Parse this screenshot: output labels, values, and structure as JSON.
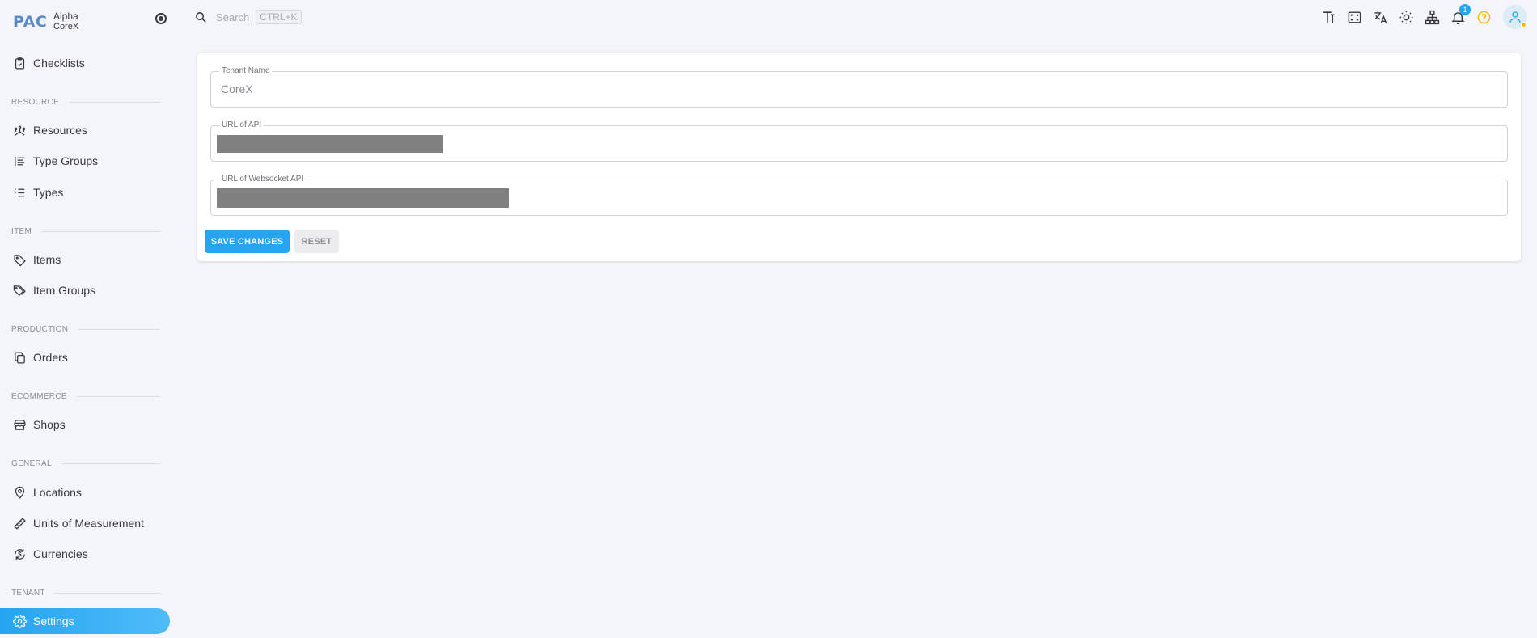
{
  "brand": {
    "logo": "PAC",
    "line1": "Alpha",
    "line2": "CoreX"
  },
  "sidebar": {
    "top_item": {
      "label": "Checklists",
      "icon": "checklist-icon"
    },
    "sections": [
      {
        "title": "RESOURCE",
        "items": [
          {
            "label": "Resources",
            "icon": "resources-icon"
          },
          {
            "label": "Type Groups",
            "icon": "type-groups-icon"
          },
          {
            "label": "Types",
            "icon": "types-icon"
          }
        ]
      },
      {
        "title": "ITEM",
        "items": [
          {
            "label": "Items",
            "icon": "tag-icon"
          },
          {
            "label": "Item Groups",
            "icon": "tags-icon"
          }
        ]
      },
      {
        "title": "PRODUCTION",
        "items": [
          {
            "label": "Orders",
            "icon": "orders-icon"
          }
        ]
      },
      {
        "title": "ECOMMERCE",
        "items": [
          {
            "label": "Shops",
            "icon": "shop-icon"
          }
        ]
      },
      {
        "title": "GENERAL",
        "items": [
          {
            "label": "Locations",
            "icon": "location-icon"
          },
          {
            "label": "Units of Measurement",
            "icon": "ruler-icon"
          },
          {
            "label": "Currencies",
            "icon": "currency-icon"
          }
        ]
      },
      {
        "title": "TENANT",
        "items": [
          {
            "label": "Settings",
            "icon": "gear-icon",
            "active": true
          }
        ]
      }
    ]
  },
  "search": {
    "placeholder": "Search",
    "shortcut": "CTRL+K"
  },
  "topbar": {
    "icons": [
      "text-size-icon",
      "fullscreen-icon",
      "translate-icon",
      "theme-icon",
      "sitemap-icon",
      "bell-icon",
      "help-icon",
      "user-avatar-icon"
    ],
    "notification_count": "1"
  },
  "form": {
    "tenant_name": {
      "label": "Tenant Name",
      "value": "CoreX"
    },
    "api_url": {
      "label": "URL of API",
      "value_redacted": true
    },
    "ws_url": {
      "label": "URL of Websocket API",
      "value_redacted": true
    },
    "save_label": "SAVE CHANGES",
    "reset_label": "RESET"
  },
  "colors": {
    "accent": "#26a4ef",
    "background": "#f4f5fa",
    "help": "#ffb400"
  }
}
